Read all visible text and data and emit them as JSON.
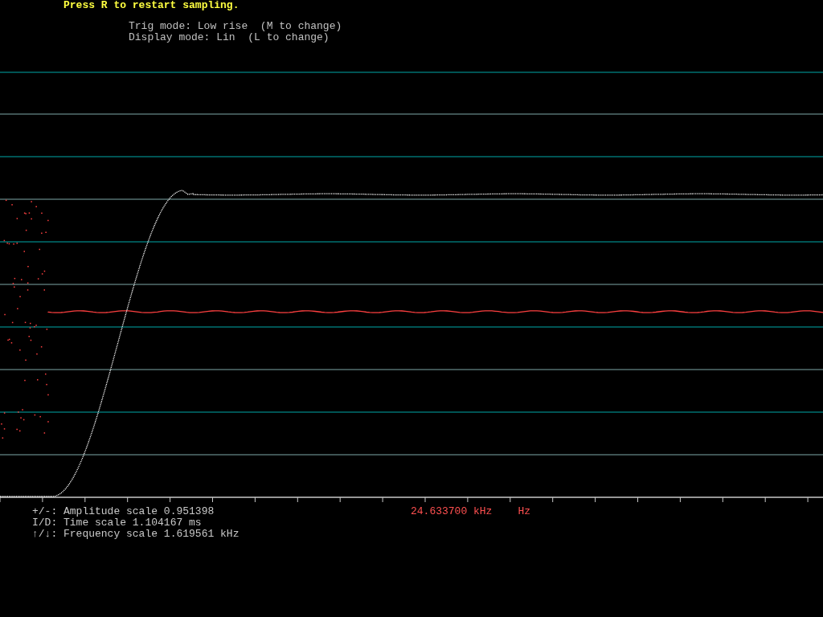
{
  "header": {
    "prompt": "Press R to restart sampling.",
    "modes": [
      "Trig mode: Low rise  (M to change)",
      "Display mode: Lin  (L to change)"
    ]
  },
  "scales": [
    "+/-: Amplitude scale 0.951398",
    "I/D: Time scale 1.104167 ms",
    "↑/↓: Frequency scale 1.619561 kHz"
  ],
  "frequency": {
    "reading": "24.633700 kHz",
    "unit": "Hz"
  }
}
